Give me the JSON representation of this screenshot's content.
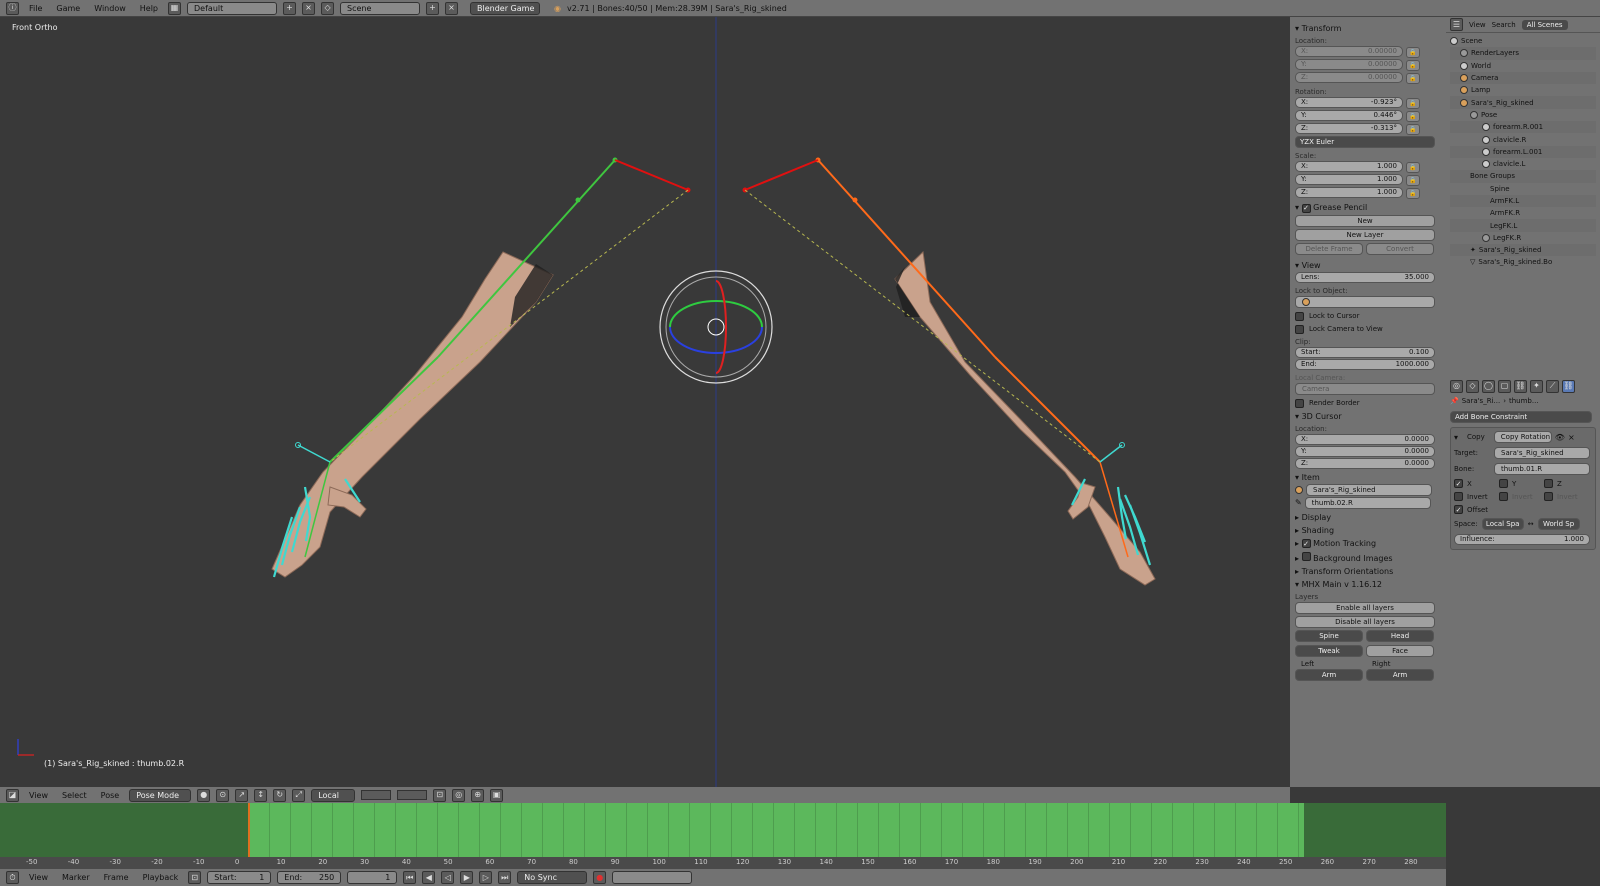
{
  "topbar": {
    "menus": [
      "File",
      "Game",
      "Window",
      "Help"
    ],
    "screen_layout": "Default",
    "scene": "Scene",
    "engine": "Blender Game",
    "info": "v2.71 | Bones:40/50 | Mem:28.39M | Sara's_Rig_skined"
  },
  "viewport": {
    "view_name": "Front Ortho",
    "status": "(1) Sara's_Rig_skined : thumb.02.R"
  },
  "view_header": {
    "menus": [
      "View",
      "Select",
      "Pose"
    ],
    "mode": "Pose Mode",
    "orientation": "Local"
  },
  "timeline": {
    "ruler": [
      "-50",
      "-40",
      "-30",
      "-20",
      "-10",
      "0",
      "10",
      "20",
      "30",
      "40",
      "50",
      "60",
      "70",
      "80",
      "90",
      "100",
      "110",
      "120",
      "130",
      "140",
      "150",
      "160",
      "170",
      "180",
      "190",
      "200",
      "210",
      "220",
      "230",
      "240",
      "250",
      "260",
      "270",
      "280"
    ],
    "header": {
      "menus": [
        "View",
        "Marker",
        "Frame",
        "Playback"
      ],
      "start_label": "Start:",
      "start": "1",
      "end_label": "End:",
      "end": "250",
      "current": "1",
      "sync": "No Sync"
    }
  },
  "properties": {
    "transform": {
      "title": "Transform",
      "location_label": "Location:",
      "location": [
        {
          "axis": "X:",
          "value": "0.00000"
        },
        {
          "axis": "Y:",
          "value": "0.00000"
        },
        {
          "axis": "Z:",
          "value": "0.00000"
        }
      ],
      "rotation_label": "Rotation:",
      "rotation": [
        {
          "axis": "X:",
          "value": "-0.923°"
        },
        {
          "axis": "Y:",
          "value": "0.446°"
        },
        {
          "axis": "Z:",
          "value": "-0.313°"
        }
      ],
      "rotation_mode": "YZX Euler",
      "scale_label": "Scale:",
      "scale": [
        {
          "axis": "X:",
          "value": "1.000"
        },
        {
          "axis": "Y:",
          "value": "1.000"
        },
        {
          "axis": "Z:",
          "value": "1.000"
        }
      ]
    },
    "grease_pencil": {
      "title": "Grease Pencil",
      "new": "New",
      "new_layer": "New Layer",
      "delete_frame": "Delete Frame",
      "convert": "Convert"
    },
    "view": {
      "title": "View",
      "lens_label": "Lens:",
      "lens": "35.000",
      "lock_to_object": "Lock to Object:",
      "lock_to_cursor": "Lock to Cursor",
      "lock_camera": "Lock Camera to View",
      "clip": "Clip:",
      "start_label": "Start:",
      "start": "0.100",
      "end_label": "End:",
      "end": "1000.000",
      "local_camera": "Local Camera:",
      "camera": "Camera",
      "render_border": "Render Border"
    },
    "cursor3d": {
      "title": "3D Cursor",
      "location_label": "Location:",
      "location": [
        {
          "axis": "X:",
          "value": "0.0000"
        },
        {
          "axis": "Y:",
          "value": "0.0000"
        },
        {
          "axis": "Z:",
          "value": "0.0000"
        }
      ]
    },
    "item": {
      "title": "Item",
      "object": "Sara's_Rig_skined",
      "bone": "thumb.02.R"
    },
    "panels": [
      "Display",
      "Shading",
      "Motion Tracking",
      "Background Images",
      "Transform Orientations"
    ],
    "mhx": {
      "title": "MHX Main v 1.16.12",
      "layers": "Layers",
      "enable_all": "Enable all layers",
      "disable_all": "Disable all layers",
      "spine": "Spine",
      "head": "Head",
      "tweak": "Tweak",
      "face": "Face",
      "left": "Left",
      "right": "Right",
      "arm_l": "Arm",
      "arm_r": "Arm"
    }
  },
  "outliner": {
    "tabs": [
      "View",
      "Search",
      "All Scenes"
    ],
    "rows": [
      "Scene",
      "RenderLayers",
      "World",
      "Camera",
      "Lamp",
      "Sara's_Rig_skined",
      "Pose",
      "forearm.R.001",
      "clavicle.R",
      "forearm.L.001",
      "clavicle.L",
      "Bone Groups",
      "Spine",
      "ArmFK.L",
      "ArmFK.R",
      "LegFK.L",
      "LegFK.R",
      "Sara's_Rig_skined",
      "Sara's_Rig_skined.Bo"
    ]
  },
  "bone_constraints": {
    "breadcrumb_obj": "Sara's_Ri...",
    "breadcrumb_bone": "thumb...",
    "add": "Add Bone Constraint",
    "name": "Copy",
    "type": "Copy Rotation",
    "target_label": "Target:",
    "target": "Sara's_Rig_skined",
    "bone_label": "Bone:",
    "bone": "thumb.01.R",
    "x": "X",
    "y": "Y",
    "z": "Z",
    "invert": "Invert",
    "offset": "Offset",
    "space_label": "Space:",
    "space_from": "Local Spa",
    "space_to": "World Sp",
    "influence_label": "Influence:",
    "influence": "1.000"
  },
  "colors": {
    "bg": "#393939",
    "panel": "#727272",
    "timeline_range": "#5cb85c",
    "bone_green": "#3fc63f",
    "bone_orange": "#ff6a1a",
    "bone_red": "#e01010",
    "ik_cyan": "#3fd9d0",
    "skin": "#c9a28c"
  }
}
